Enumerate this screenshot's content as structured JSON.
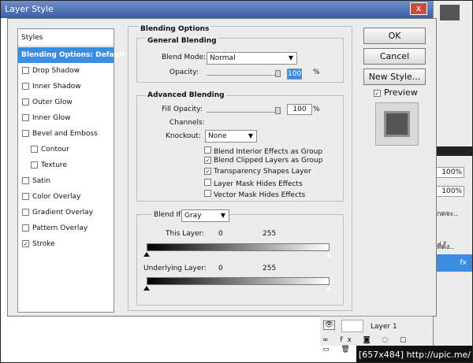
{
  "window": {
    "title": "Layer Style",
    "close_label": "x"
  },
  "styles": {
    "header": "Styles",
    "items": [
      {
        "label": "Blending Options: Default",
        "checked": false,
        "active": true
      },
      {
        "label": "Drop Shadow",
        "checked": false
      },
      {
        "label": "Inner Shadow",
        "checked": false
      },
      {
        "label": "Outer Glow",
        "checked": false
      },
      {
        "label": "Inner Glow",
        "checked": false
      },
      {
        "label": "Bevel and Emboss",
        "checked": false
      },
      {
        "label": "Contour",
        "checked": false,
        "sub": true
      },
      {
        "label": "Texture",
        "checked": false,
        "sub": true
      },
      {
        "label": "Satin",
        "checked": false
      },
      {
        "label": "Color Overlay",
        "checked": false
      },
      {
        "label": "Gradient Overlay",
        "checked": false
      },
      {
        "label": "Pattern Overlay",
        "checked": false
      },
      {
        "label": "Stroke",
        "checked": true
      }
    ]
  },
  "blending": {
    "section_title": "Blending Options",
    "general_title": "General Blending",
    "blend_mode_label": "Blend Mode:",
    "blend_mode_value": "Normal",
    "opacity_label": "Opacity:",
    "opacity_value": "100",
    "opacity_unit": "%",
    "advanced_title": "Advanced Blending",
    "fill_opacity_label": "Fill Opacity:",
    "fill_opacity_value": "100",
    "fill_opacity_unit": "%",
    "channels_label": "Channels:",
    "knockout_label": "Knockout:",
    "knockout_value": "None",
    "options": [
      {
        "label": "Blend Interior Effects as Group",
        "checked": false
      },
      {
        "label": "Blend Clipped Layers as Group",
        "checked": true
      },
      {
        "label": "Transparency Shapes Layer",
        "checked": true
      },
      {
        "label": "Layer Mask Hides Effects",
        "checked": false
      },
      {
        "label": "Vector Mask Hides Effects",
        "checked": false
      }
    ]
  },
  "blend_if": {
    "label": "Blend If:",
    "value": "Gray",
    "this_layer_label": "This Layer:",
    "this_layer_min": "0",
    "this_layer_max": "255",
    "underlying_label": "Underlying Layer:",
    "underlying_min": "0",
    "underlying_max": "255"
  },
  "buttons": {
    "ok": "OK",
    "cancel": "Cancel",
    "new_style": "New Style...",
    "preview": "Preview"
  },
  "background": {
    "layer_name": "Layer 1",
    "pct_1": "100%",
    "pct_2": "100%",
    "text_1": "กดจะ..",
    "text_2": "ที่ตั้ง..",
    "status": "[657x484] http://upic.me/"
  }
}
